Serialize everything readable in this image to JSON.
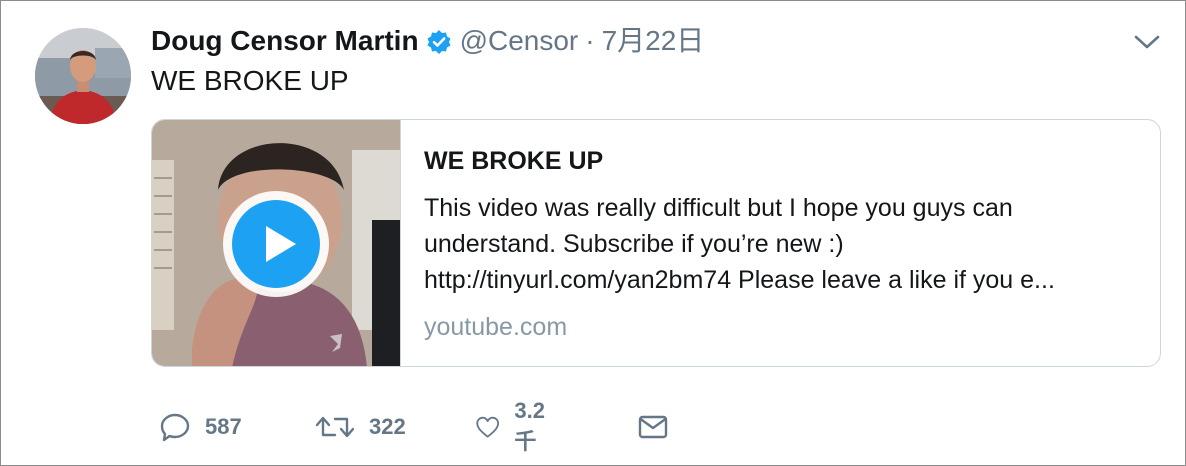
{
  "tweet": {
    "display_name": "Doug Censor Martin",
    "handle": "@Censor",
    "separator": "·",
    "date": "7月22日",
    "text": "WE BROKE UP",
    "avatar_icon": "user-avatar-photo",
    "verified_color": "#1da1f2"
  },
  "card": {
    "title": "WE BROKE UP",
    "description_lines": [
      "This video was really difficult but I hope you guys can",
      "understand. Subscribe if you’re new :)",
      "http://tinyurl.com/yan2bm74 Please leave a like if you e..."
    ],
    "domain": "youtube.com",
    "thumbnail_icon": "video-thumbnail",
    "play_color": "#1da1f2"
  },
  "actions": {
    "reply": {
      "icon": "reply-icon",
      "count": "587"
    },
    "retweet": {
      "icon": "retweet-icon",
      "count": "322"
    },
    "like": {
      "icon": "heart-icon",
      "count": "3.2千"
    },
    "dm": {
      "icon": "envelope-icon"
    }
  },
  "colors": {
    "text": "#14171a",
    "secondary": "#657786",
    "domain": "#8899a6",
    "border": "#ccd6dd"
  }
}
